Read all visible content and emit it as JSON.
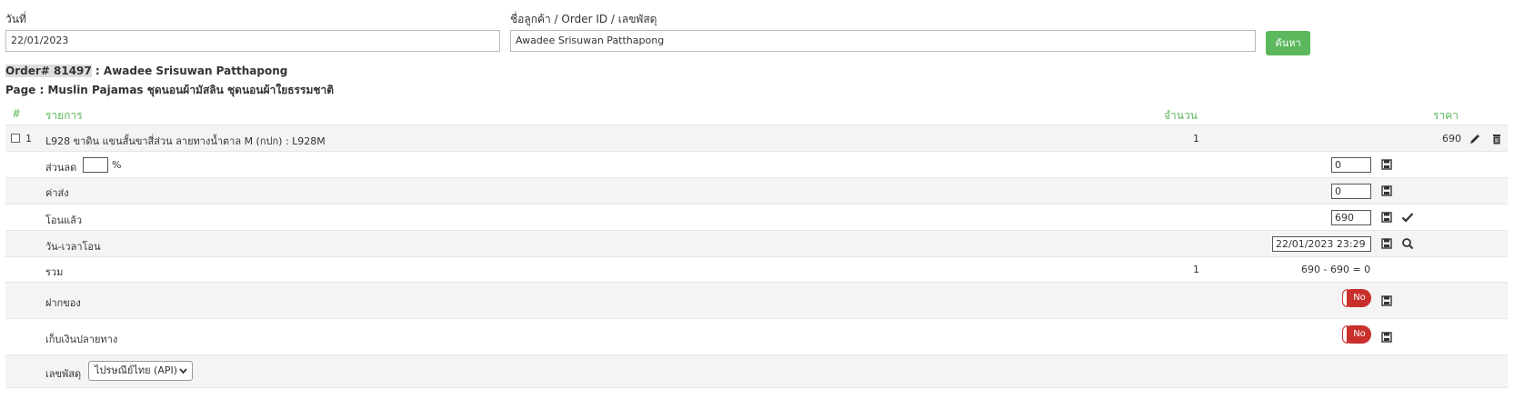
{
  "filters": {
    "date_label": "วันที่",
    "date_value": "22/01/2023",
    "customer_label": "ชื่อลูกค้า / Order ID / เลขพัสดุ",
    "customer_value": "Awadee Srisuwan Patthapong",
    "search_button": "ค้นหา"
  },
  "order": {
    "order_id_text": "Order# 81497",
    "customer_suffix": " : Awadee Srisuwan Patthapong",
    "page_line": "Page : Muslin Pajamas ชุดนอนผ้ามัสลิน ชุดนอนผ้าใยธรรมชาติ"
  },
  "table": {
    "headers": {
      "num": "#",
      "item": "รายการ",
      "qty": "จำนวน",
      "price": "ราคา"
    },
    "items": [
      {
        "num": "1",
        "name": "L928 ขาดิน แขนสั้นขาสี่ส่วน ลายทางน้ำตาล M (กปก) : L928M",
        "qty": "1",
        "price": "690"
      }
    ],
    "discount": {
      "label": "ส่วนลด",
      "percent_value": "",
      "percent_sign": "%",
      "value": "0"
    },
    "shipping": {
      "label": "ค่าส่ง",
      "value": "0"
    },
    "transferred": {
      "label": "โอนแล้ว",
      "value": "690"
    },
    "transfer_time": {
      "label": "วัน-เวลาโอน",
      "value": "22/01/2023 23:29"
    },
    "total": {
      "label": "รวม",
      "qty": "1",
      "value": "690 - 690 = 0"
    },
    "deposit": {
      "label": "ฝากของ",
      "toggle": "No"
    },
    "cod": {
      "label": "เก็บเงินปลายทาง",
      "toggle": "No"
    },
    "tracking": {
      "label": "เลขพัสดุ",
      "carrier": "ไปรษณีย์ไทย (API)"
    }
  },
  "colors": {
    "accent": "#5cb85c",
    "danger": "#c9302c"
  }
}
